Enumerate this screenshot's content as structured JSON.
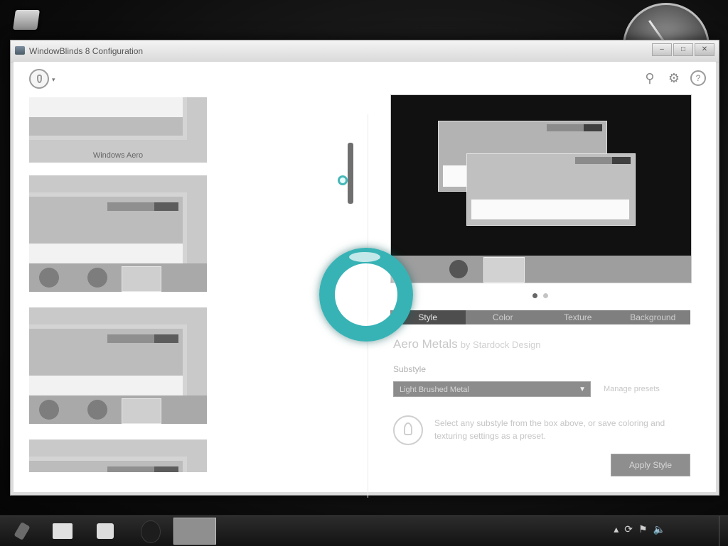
{
  "window": {
    "title": "WindowBlinds 8 Configuration",
    "buttons": {
      "minimize": "–",
      "maximize": "□",
      "close": "✕"
    }
  },
  "toolbar": {
    "menu_arrow": "▾",
    "search_icon": "⚲",
    "settings_icon": "⚙",
    "help_icon": "?"
  },
  "thumbnails": [
    {
      "label": "Windows Aero"
    },
    {
      "label": ""
    },
    {
      "label": ""
    },
    {
      "label": ""
    }
  ],
  "preview": {
    "page_indicator": {
      "count": 2,
      "active": 0
    }
  },
  "tabs": [
    {
      "label": "Style",
      "active": true
    },
    {
      "label": "Color",
      "active": false
    },
    {
      "label": "Texture",
      "active": false
    },
    {
      "label": "Background",
      "active": false
    }
  ],
  "style": {
    "name": "Aero Metals",
    "author": "by Stardock Design"
  },
  "substyle": {
    "label": "Substyle",
    "selected": "Light Brushed Metal",
    "manage_link": "Manage presets"
  },
  "tip": {
    "text": "Select any substyle from the box above, or save coloring and texturing settings as a preset."
  },
  "apply_button": "Apply Style",
  "taskbar": {
    "tray_icons": [
      "▴",
      "⟳",
      "⚑",
      "🔈"
    ]
  },
  "colors": {
    "accent_cursor": "#37b3b6",
    "active_tab": "#4e4e4e"
  }
}
